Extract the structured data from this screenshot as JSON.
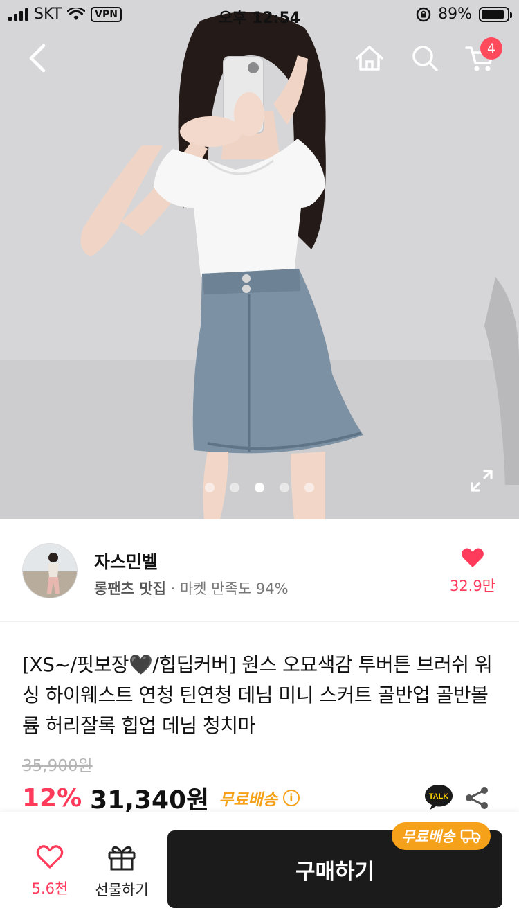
{
  "status_bar": {
    "carrier": "SKT",
    "vpn": "VPN",
    "time": "오후 12:54",
    "battery": "89%"
  },
  "nav": {
    "back_icon": "chevron-left-icon",
    "home_icon": "home-icon",
    "search_icon": "search-icon",
    "cart_icon": "cart-icon",
    "cart_count": "4"
  },
  "gallery": {
    "total_images": 5,
    "active_index": 3,
    "expand_icon": "expand-icon"
  },
  "seller": {
    "name": "자스민벨",
    "tagline": "롱팬츠 맛집",
    "satisfaction": "· 마켓 만족도 94%",
    "likes": "32.9만"
  },
  "product": {
    "title": "[XS~/핏보장🖤/힙딥커버] 원스 오묘색감 투버튼 브러쉬 워싱 하이웨스트 연청 틴연청 데님 미니 스커트 골반업 골반볼륨 허리잘록 힙업 데님 청치마",
    "original_price": "35,900원",
    "discount": "12%",
    "price": "31,340원",
    "free_shipping": "무료배송",
    "talk_label": "TALK"
  },
  "bottom_bar": {
    "wish_count": "5.6천",
    "gift_label": "선물하기",
    "buy_label": "구매하기",
    "ship_badge": "무료배송"
  },
  "colors": {
    "accent_red": "#ff3b5c",
    "shipping_orange": "#f6a11a",
    "buy_button": "#1b1b1b"
  }
}
